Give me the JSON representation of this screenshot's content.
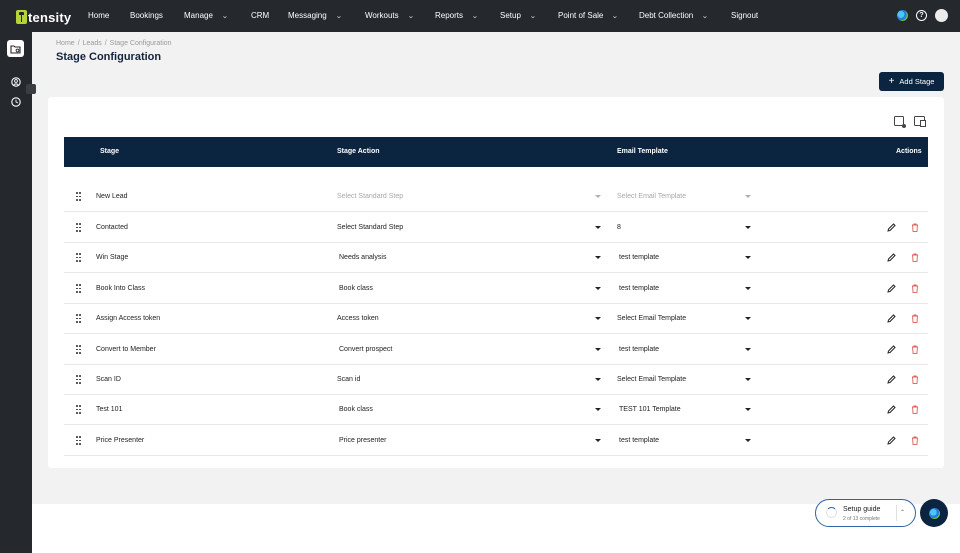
{
  "app": {
    "logo_text": "tensity"
  },
  "nav": {
    "items": [
      {
        "label": "Home",
        "has_menu": false
      },
      {
        "label": "Bookings",
        "has_menu": false
      },
      {
        "label": "Manage",
        "has_menu": true
      },
      {
        "label": "CRM",
        "has_menu": false
      },
      {
        "label": "Messaging",
        "has_menu": true
      },
      {
        "label": "Workouts",
        "has_menu": true
      },
      {
        "label": "Reports",
        "has_menu": true
      },
      {
        "label": "Setup",
        "has_menu": true
      },
      {
        "label": "Point of Sale",
        "has_menu": true
      },
      {
        "label": "Debt Collection",
        "has_menu": true
      },
      {
        "label": "Signout",
        "has_menu": false
      }
    ],
    "right_icons": [
      "globe-icon",
      "help-icon",
      "user-avatar"
    ]
  },
  "sidebar": {
    "icons": [
      "folder-settings-icon",
      "user-circle-icon",
      "clock-circle-icon"
    ]
  },
  "breadcrumb": [
    "Home",
    "/",
    "Leads",
    "/",
    "Stage Configuration"
  ],
  "page": {
    "title": "Stage Configuration",
    "add_button_label": "Add Stage"
  },
  "table": {
    "headers": {
      "stage": "Stage",
      "action": "Stage Action",
      "email": "Email Template",
      "actions": "Actions"
    },
    "rows": [
      {
        "stage": "New Lead",
        "action": "Select Standard Step",
        "email": "Select Email Template",
        "disabled": true
      },
      {
        "stage": "Contacted",
        "action": "Select Standard Step",
        "email": "8",
        "disabled": false
      },
      {
        "stage": "Win Stage",
        "action": "Needs analysis",
        "email": "test template",
        "disabled": false
      },
      {
        "stage": "Book Into Class",
        "action": "Book class",
        "email": "test template",
        "disabled": false
      },
      {
        "stage": "Assign Access token",
        "action": "Access token",
        "email": "Select Email Template",
        "disabled": false
      },
      {
        "stage": "Convert to Member",
        "action": "Convert prospect",
        "email": "test template",
        "disabled": false
      },
      {
        "stage": "Scan ID",
        "action": "Scan id",
        "email": "Select Email Template",
        "disabled": false
      },
      {
        "stage": "Test 101",
        "action": "Book class",
        "email": "TEST 101 Template",
        "disabled": false
      },
      {
        "stage": "Price Presenter",
        "action": "Price presenter",
        "email": "test template",
        "disabled": false
      }
    ]
  },
  "setup_guide": {
    "title": "Setup guide",
    "progress": "2 of 13 complete"
  },
  "colors": {
    "nav_bg": "#25282d",
    "header_bg": "#0b2540",
    "delete": "#e05a5a",
    "accent_logo": "#b5d33b"
  }
}
